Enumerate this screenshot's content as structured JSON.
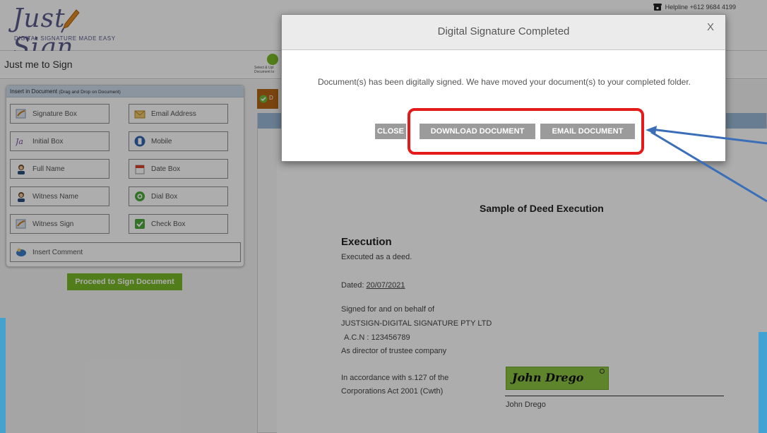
{
  "header": {
    "logo_text": "Just Sign",
    "logo_tagline": "DIGITAL SIGNATURE MADE EASY",
    "helpline": "Helpline +612 9684 4199"
  },
  "titlebar": {
    "title": "Just me to Sign",
    "step_number": "1",
    "step_caption_1": "Select & Upl",
    "step_caption_2": "Document to"
  },
  "panel": {
    "heading": "Insert in Document",
    "heading_hint": "(Drag and Drop on Document)",
    "tools": [
      {
        "label": "Signature Box",
        "icon": "signature-icon"
      },
      {
        "label": "Email Address",
        "icon": "email-icon"
      },
      {
        "label": "Initial Box",
        "icon": "initial-icon"
      },
      {
        "label": "Mobile",
        "icon": "mobile-icon"
      },
      {
        "label": "Full Name",
        "icon": "person-icon"
      },
      {
        "label": "Date Box",
        "icon": "calendar-icon"
      },
      {
        "label": "Witness Name",
        "icon": "person-icon"
      },
      {
        "label": "Dial Box",
        "icon": "dial-icon"
      },
      {
        "label": "Witness Sign",
        "icon": "signature-icon"
      },
      {
        "label": "Check Box",
        "icon": "checkbox-icon"
      },
      {
        "label": "Insert Comment",
        "icon": "comment-icon"
      }
    ],
    "proceed_label": "Proceed to Sign Document"
  },
  "document": {
    "strip_label": "D",
    "title": "Sample of Deed Execution",
    "heading": "Execution",
    "line_executed": "Executed as a deed.",
    "dated_label": "Dated: ",
    "dated_value": "20/07/2021",
    "signed_line_1": "Signed for and on behalf of",
    "signed_line_2": "JUSTSIGN-DIGITAL SIGNATURE PTY LTD",
    "signed_line_3": "A.C.N : 123456789",
    "signed_line_4": "As director of trustee company",
    "accordance_1": "In accordance with s.127 of the",
    "accordance_2": "Corporations Act 2001 (Cwth)",
    "signature_text": "John Drego",
    "signer_name": "John Drego"
  },
  "modal": {
    "title": "Digital Signature Completed",
    "close_x": "X",
    "message": "Document(s) has been digitally signed. We have moved your document(s) to your completed folder.",
    "btn_close": "CLOSE",
    "btn_download": "DOWNLOAD DOCUMENT",
    "btn_email": "EMAIL DOCUMENT"
  },
  "colors": {
    "brand": "#5a5a8c",
    "accent_green": "#7ab829",
    "highlight_red": "#e51b1b",
    "arrow_blue": "#3a6fb8",
    "button_gray": "#9b9b9b"
  }
}
